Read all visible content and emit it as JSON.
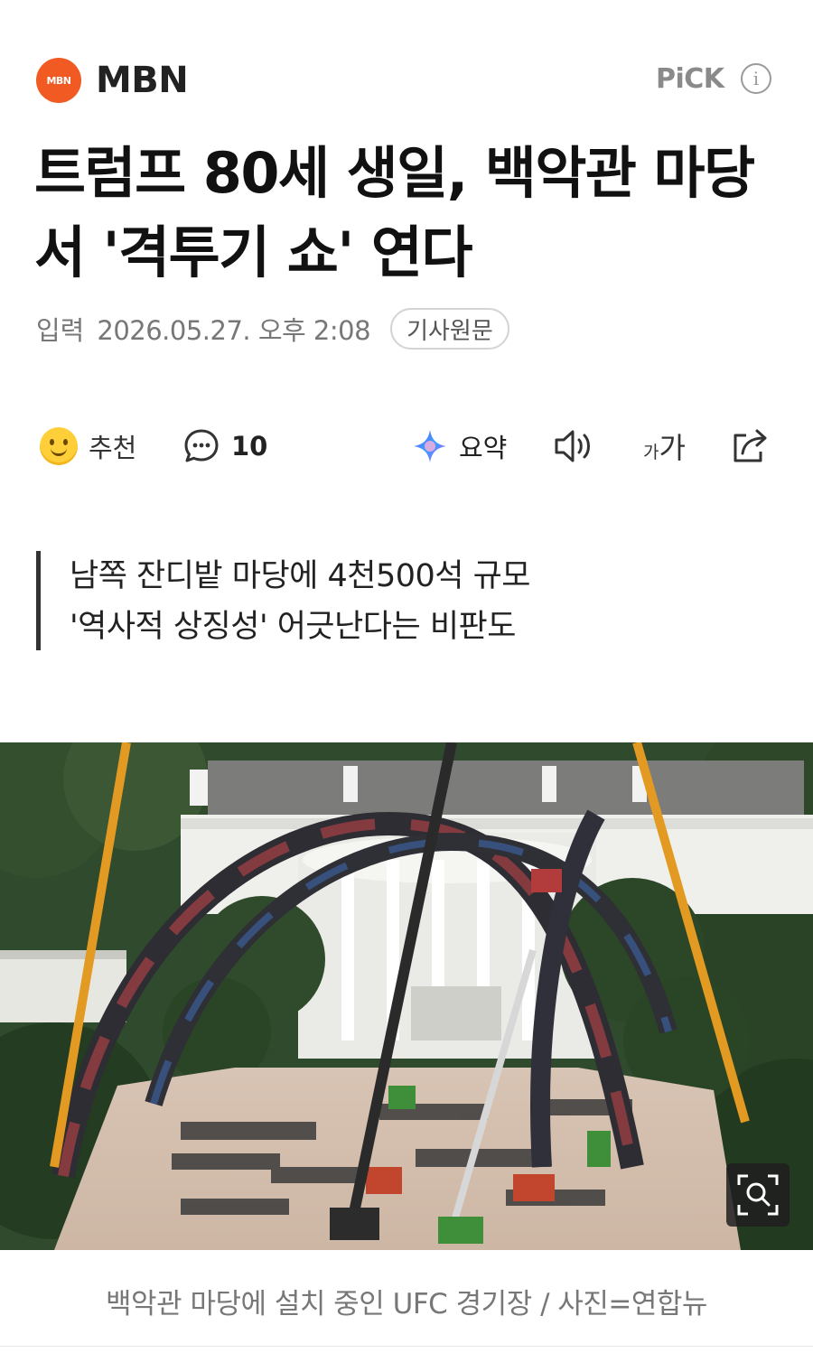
{
  "header": {
    "logo_text": "MBN",
    "press_name": "MBN",
    "pick_label": "PiCK",
    "info_icon": "info-icon",
    "brand_color": "#f15a22"
  },
  "article": {
    "title": "트럼프 80세 생일, 백악관 마당서 '격투기 쇼' 연다",
    "date_label": "입력",
    "date_value": "2026.05.27. 오후 2:08",
    "original_button": "기사원문"
  },
  "toolbar": {
    "recommend_label": "추천",
    "comment_count": "10",
    "summary_label": "요약",
    "font_size_label_small": "가",
    "font_size_label_large": "가",
    "icons": [
      "smiley-icon",
      "comment-icon",
      "ai-sparkle-icon",
      "speaker-icon",
      "font-size-icon",
      "share-icon"
    ]
  },
  "subtitle": {
    "line1": "남쪽 잔디밭 마당에 4천500석 규모",
    "line2": "'역사적 상징성' 어긋난다는 비판도"
  },
  "photo": {
    "zoom_icon": "zoom-icon",
    "caption": "백악관 마당에 설치 중인 UFC 경기장 / 사진=연합뉴"
  }
}
